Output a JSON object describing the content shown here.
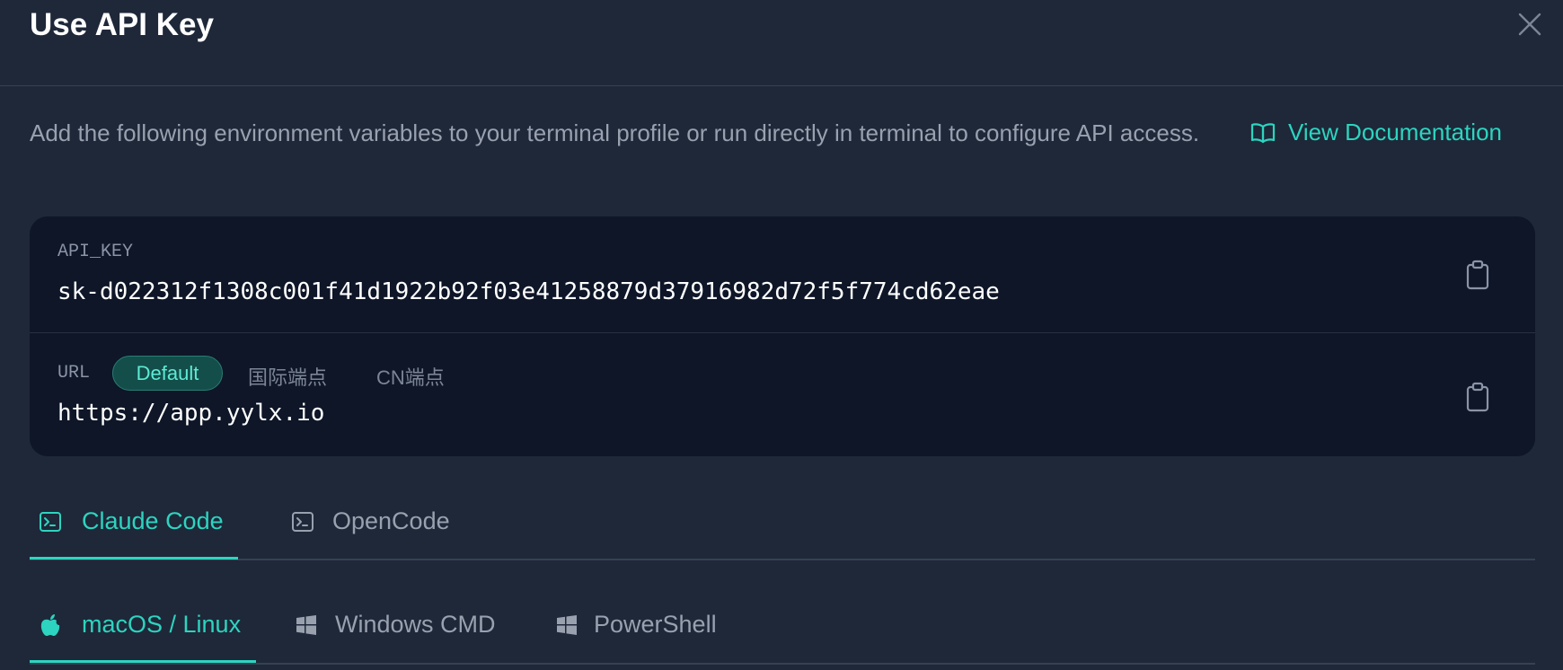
{
  "dialog": {
    "title": "Use API Key",
    "description": "Add the following environment variables to your terminal profile or run directly in terminal to configure API access.",
    "doc_link": "View Documentation"
  },
  "credentials": {
    "api_key_label": "API_KEY",
    "api_key_value": "sk-d022312f1308c001f41d1922b92f03e41258879d37916982d72f5f774cd62eae",
    "url_label": "URL",
    "url_options": [
      "Default",
      "国际端点",
      "CN端点"
    ],
    "url_selected": "Default",
    "url_value": "https://app.yylx.io"
  },
  "tool_tabs": [
    {
      "label": "Claude Code",
      "icon": "terminal-icon",
      "active": true
    },
    {
      "label": "OpenCode",
      "icon": "terminal-icon",
      "active": false
    }
  ],
  "os_tabs": [
    {
      "label": "macOS / Linux",
      "icon": "apple-icon",
      "active": true
    },
    {
      "label": "Windows CMD",
      "icon": "windows-icon",
      "active": false
    },
    {
      "label": "PowerShell",
      "icon": "windows-icon",
      "active": false
    }
  ],
  "colors": {
    "background": "#1e2839",
    "card": "#0e1628",
    "accent": "#2dd4bf",
    "muted_text": "#99a1af",
    "divider": "#364153"
  }
}
